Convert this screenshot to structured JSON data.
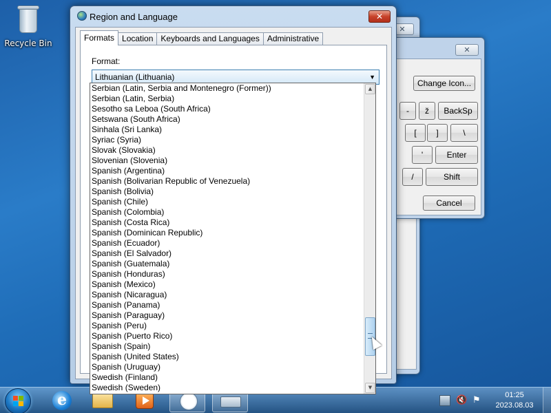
{
  "desktop": {
    "recycle_bin_label": "Recycle Bin"
  },
  "background_windows": {
    "change_icon_label": "Change Icon...",
    "keys": [
      "-",
      "ž",
      "BackSp",
      "[",
      "]",
      "\\",
      "'",
      "Enter",
      "/",
      "Shift"
    ],
    "cancel_label": "Cancel"
  },
  "dialog": {
    "title": "Region and Language",
    "close_glyph": "✕",
    "tabs": [
      {
        "label": "Formats"
      },
      {
        "label": "Location"
      },
      {
        "label": "Keyboards and Languages"
      },
      {
        "label": "Administrative"
      }
    ],
    "format_label": "Format:",
    "format_selected": "Lithuanian (Lithuania)",
    "dropdown_items": [
      "Serbian (Latin, Serbia and Montenegro (Former))",
      "Serbian (Latin, Serbia)",
      "Sesotho sa Leboa (South Africa)",
      "Setswana (South Africa)",
      "Sinhala (Sri Lanka)",
      "Syriac (Syria)",
      "Slovak (Slovakia)",
      "Slovenian (Slovenia)",
      "Spanish (Argentina)",
      "Spanish (Bolivarian Republic of Venezuela)",
      "Spanish (Bolivia)",
      "Spanish (Chile)",
      "Spanish (Colombia)",
      "Spanish (Costa Rica)",
      "Spanish (Dominican Republic)",
      "Spanish (Ecuador)",
      "Spanish (El Salvador)",
      "Spanish (Guatemala)",
      "Spanish (Honduras)",
      "Spanish (Mexico)",
      "Spanish (Nicaragua)",
      "Spanish (Panama)",
      "Spanish (Paraguay)",
      "Spanish (Peru)",
      "Spanish (Puerto Rico)",
      "Spanish (Spain)",
      "Spanish (United States)",
      "Spanish (Uruguay)",
      "Swedish (Finland)",
      "Swedish (Sweden)"
    ]
  },
  "taskbar": {
    "time": "01:25",
    "date": "2023.08.03"
  },
  "colors": {
    "desktop": "#1f6db8",
    "close_button": "#c7422a",
    "dialog_frame": "#c9dcf0",
    "combo_focus": "#3c7fb1"
  }
}
